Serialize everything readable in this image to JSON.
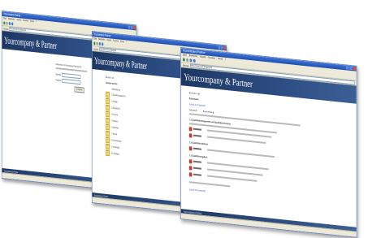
{
  "windows": [
    {
      "title": "Yourcompany Partner",
      "menus": [
        "Datei",
        "Bearbeiten",
        "Ansicht",
        "Favoriten",
        "Extras",
        "?"
      ],
      "address_label": "Adresse",
      "address": "http://www.yourcompany.de",
      "banner": "Yourcompany & Partner",
      "footer": "Yourcompany & Partner"
    },
    {
      "title": "Yourcompany Partner",
      "menus": [
        "Datei",
        "Bearbeiten",
        "Ansicht",
        "Favoriten",
        "Extras",
        "?"
      ],
      "address_label": "Adresse",
      "address": "http://www.yourcompany.de",
      "banner": "Yourcompany & Partner",
      "footer": "Yourcompany & Partner"
    },
    {
      "title": "Yourcompany Partner",
      "menus": [
        "Datei",
        "Bearbeiten",
        "Ansicht",
        "Favoriten",
        "Extras",
        "?"
      ],
      "address_label": "Adresse",
      "address": "http://www.yourcompany.de",
      "banner": "Yourcompany & Partner",
      "footer": "Yourcompany & Partner"
    }
  ],
  "login": {
    "welcome": "Willkommen im Yourcompany-Partnerportal",
    "user_label": "Benutzer:",
    "password_label": "Passwort:",
    "login_button": "Anmelden"
  },
  "toc": {
    "user": "Benutzer: ape",
    "heading": "Inhaltsverzeichnis",
    "column": "Beschreibung",
    "items": [
      "1. Qualitätsmanagement",
      "2. Verträge",
      "3. Organisation",
      "4. Personal",
      "5. Finanzen",
      "6. Marketing",
      "7. Technik",
      "8. Dokumentation",
      "9. Schulungen",
      "10. Sonstiges"
    ]
  },
  "docs": {
    "user": "Benutzer: ape",
    "heading": "Dokumente",
    "back_link": "Zurück zur Übersicht",
    "col_document": "Dokument",
    "col_description": "Beschreibung",
    "groups": [
      "1.1 Qualitätsmanagement und Qualitätssicherung",
      "1.2 Qualitätsrichtlinien",
      "1.3 Qualitätsvorgaben"
    ],
    "footer_link": "Zurück zur Übersicht"
  },
  "colors": {
    "banner": "#2e4f86",
    "titlebar": "#2b5fc6",
    "link": "#2a50a8"
  }
}
